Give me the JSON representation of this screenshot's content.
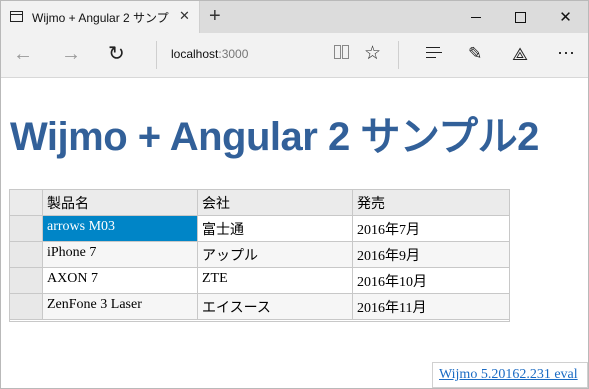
{
  "browser": {
    "tab_title": "Wijmo + Angular 2 サンプ",
    "tab_close": "✕",
    "new_tab": "+",
    "address_host": "localhost",
    "address_port": ":3000",
    "window_close": "✕"
  },
  "page": {
    "title": "Wijmo + Angular 2 サンプル2"
  },
  "grid": {
    "columns": [
      "製品名",
      "会社",
      "発売"
    ],
    "rows": [
      [
        "arrows M03",
        "富士通",
        "2016年7月"
      ],
      [
        "iPhone 7",
        "アップル",
        "2016年9月"
      ],
      [
        "AXON 7",
        "ZTE",
        "2016年10月"
      ],
      [
        "ZenFone 3 Laser",
        "エイスース",
        "2016年11月"
      ]
    ]
  },
  "footer": {
    "eval_link": "Wijmo 5.20162.231 eval"
  },
  "colors": {
    "title": "#326099",
    "selection": "#0085c7",
    "link": "#1a6bc4"
  }
}
